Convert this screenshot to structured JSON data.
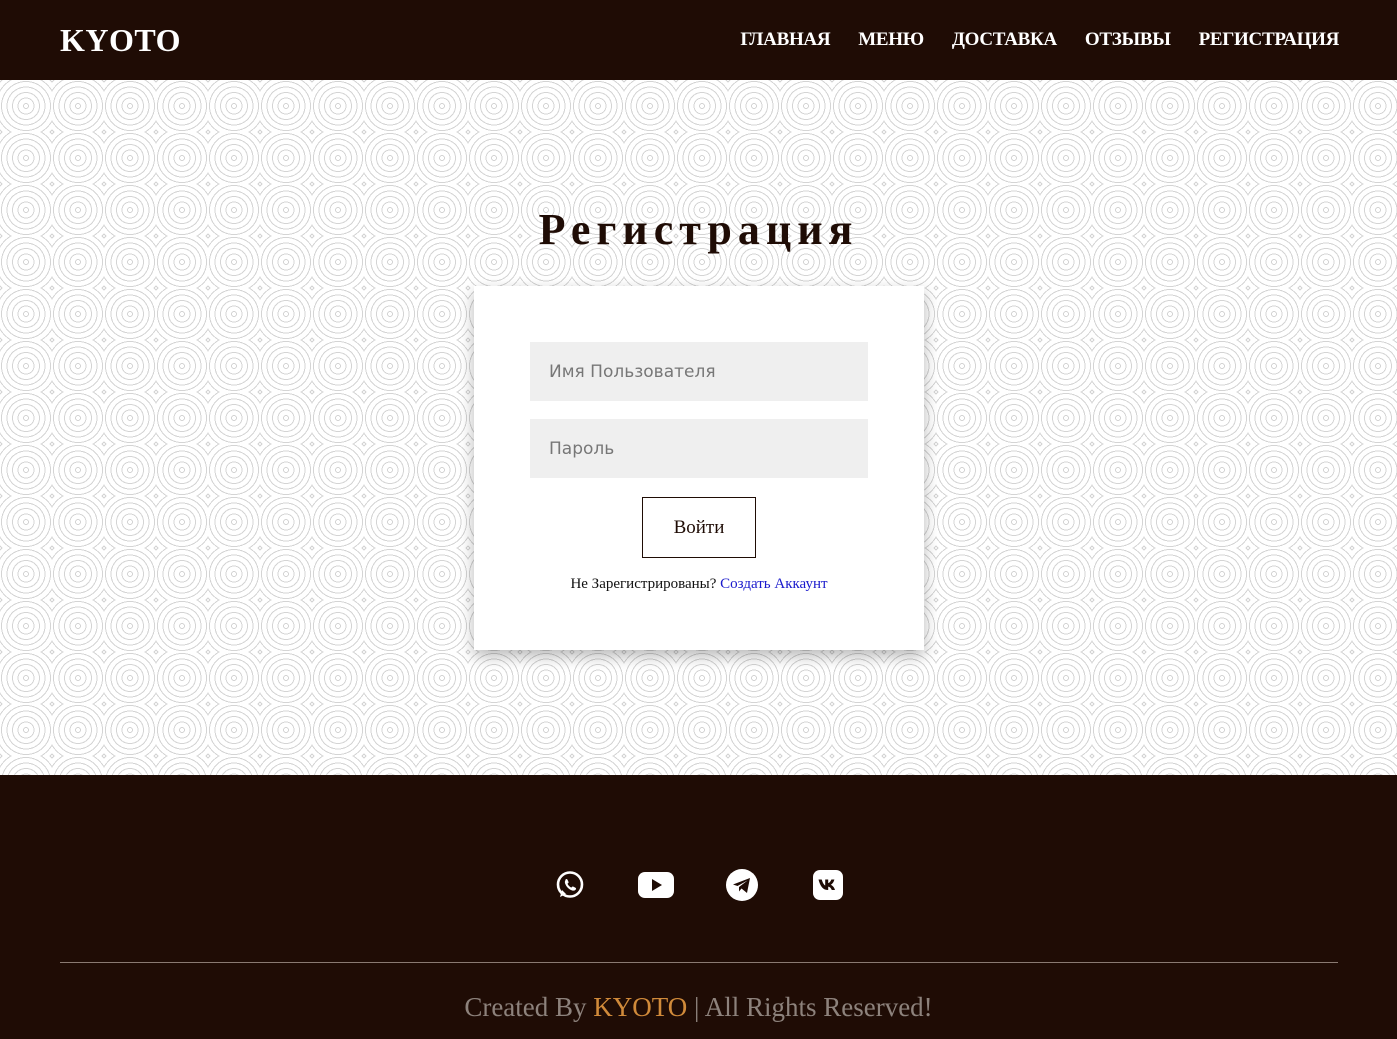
{
  "header": {
    "logo": "KYOTO",
    "nav": [
      "ГЛАВНАЯ",
      "МЕНЮ",
      "ДОСТАВКА",
      "ОТЗЫВЫ",
      "РЕГИСТРАЦИЯ"
    ]
  },
  "main": {
    "title": "Регистрация",
    "form": {
      "username_placeholder": "Имя Пользователя",
      "password_placeholder": "Пароль",
      "submit_label": "Войти",
      "signup_prompt": "Не Зарегистрированы?",
      "signup_link": "Создать Аккаунт"
    }
  },
  "footer": {
    "socials": [
      "whatsapp-icon",
      "youtube-icon",
      "telegram-icon",
      "vk-icon"
    ],
    "copyright_prefix": "Created By",
    "copyright_brand": "KYOTO",
    "copyright_suffix": "| All Rights Reserved!"
  },
  "colors": {
    "brand_dark": "#1f0c05",
    "accent": "#d08a3a",
    "link": "#1a1acc"
  }
}
